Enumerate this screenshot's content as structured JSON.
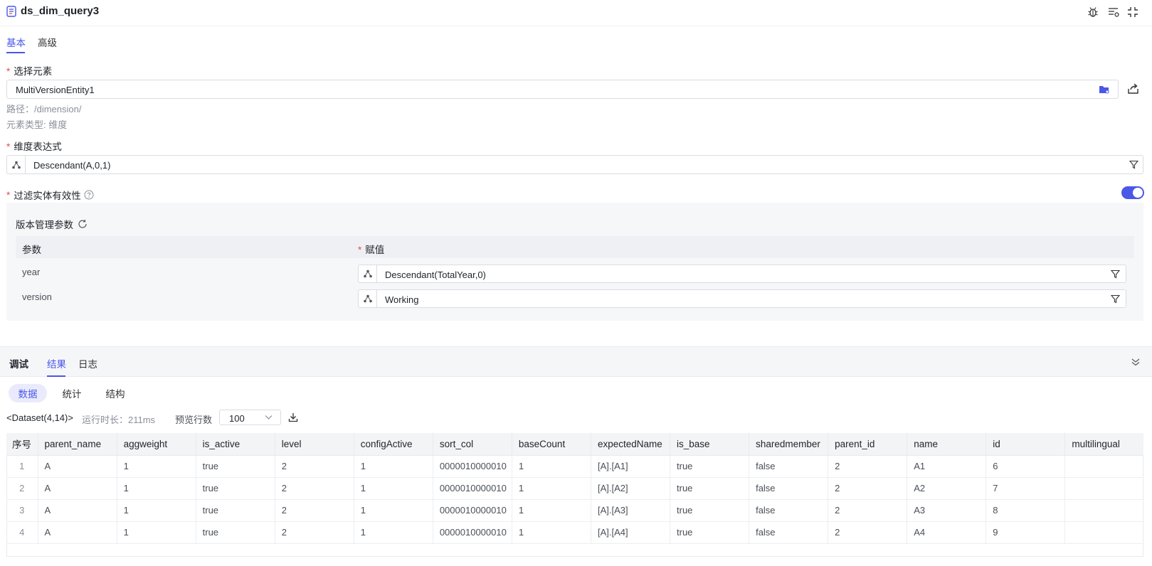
{
  "header": {
    "title": "ds_dim_query3",
    "actions": [
      "bug-icon",
      "list-settings-icon",
      "collapse-icon"
    ]
  },
  "tabs": [
    {
      "label": "基本",
      "active": true
    },
    {
      "label": "高级",
      "active": false
    }
  ],
  "element": {
    "label": "选择元素",
    "required_mark": "*",
    "value": "MultiVersionEntity1",
    "path": "路径：/dimension/",
    "type": "元素类型: 维度"
  },
  "dim_expr": {
    "label": "维度表达式",
    "required_mark": "*",
    "value": "Descendant(A,0,1)"
  },
  "filter_validity": {
    "label": "过滤实体有效性",
    "required_mark": "*",
    "enabled": true
  },
  "version_params": {
    "title": "版本管理参数",
    "col_param": "参数",
    "col_value": "赋值",
    "required_mark": "*",
    "rows": [
      {
        "param": "year",
        "value": "Descendant(TotalYear,0)"
      },
      {
        "param": "version",
        "value": "Working"
      }
    ]
  },
  "bottom": {
    "tabs": [
      {
        "label": "调试",
        "active": false,
        "bold": true
      },
      {
        "label": "结果",
        "active": true
      },
      {
        "label": "日志",
        "active": false
      }
    ],
    "subtabs": [
      {
        "label": "数据",
        "active": true
      },
      {
        "label": "统计",
        "active": false
      },
      {
        "label": "结构",
        "active": false
      }
    ],
    "dataset": "<Dataset(4,14)>",
    "runtime": "运行时长：211ms",
    "preview_label": "预览行数",
    "preview_value": "100"
  },
  "results": {
    "columns": [
      "序号",
      "parent_name",
      "aggweight",
      "is_active",
      "level",
      "configActive",
      "sort_col",
      "baseCount",
      "expectedName",
      "is_base",
      "sharedmember",
      "parent_id",
      "name",
      "id",
      "multilingual"
    ],
    "rows": [
      [
        "1",
        "A",
        "1",
        "true",
        "2",
        "1",
        "0000010000010",
        "1",
        "[A].[A1]",
        "true",
        "false",
        "2",
        "A1",
        "6",
        ""
      ],
      [
        "2",
        "A",
        "1",
        "true",
        "2",
        "1",
        "0000010000010",
        "1",
        "[A].[A2]",
        "true",
        "false",
        "2",
        "A2",
        "7",
        ""
      ],
      [
        "3",
        "A",
        "1",
        "true",
        "2",
        "1",
        "0000010000010",
        "1",
        "[A].[A3]",
        "true",
        "false",
        "2",
        "A3",
        "8",
        ""
      ],
      [
        "4",
        "A",
        "1",
        "true",
        "2",
        "1",
        "0000010000010",
        "1",
        "[A].[A4]",
        "true",
        "false",
        "2",
        "A4",
        "9",
        ""
      ]
    ]
  },
  "colors": {
    "accent": "#4b57e8",
    "required": "#e34d4d"
  }
}
